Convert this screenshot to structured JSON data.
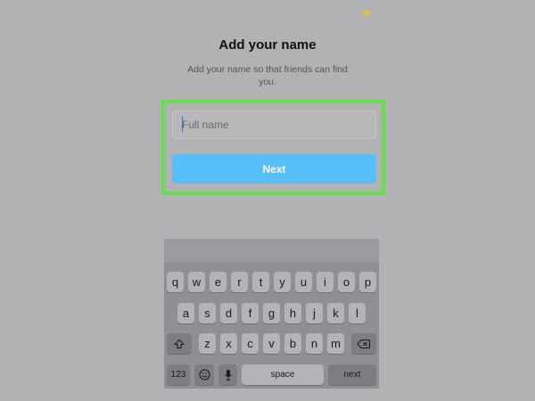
{
  "status_bar": {
    "battery_color": "#e2c23a"
  },
  "screen": {
    "title": "Add your name",
    "subtitle": "Add your name so that friends can find you.",
    "input_placeholder": "Full name",
    "input_value": "",
    "next_label": "Next",
    "highlight_color": "#63e04a",
    "accent_color": "#56bef8"
  },
  "keyboard": {
    "row1": [
      "q",
      "w",
      "e",
      "r",
      "t",
      "y",
      "u",
      "i",
      "o",
      "p"
    ],
    "row2": [
      "a",
      "s",
      "d",
      "f",
      "g",
      "h",
      "j",
      "k",
      "l"
    ],
    "row3": [
      "z",
      "x",
      "c",
      "v",
      "b",
      "n",
      "m"
    ],
    "numbers_label": "123",
    "space_label": "space",
    "return_label": "next",
    "icons": [
      "shift-icon",
      "backspace-icon",
      "emoji-icon",
      "microphone-icon"
    ]
  }
}
